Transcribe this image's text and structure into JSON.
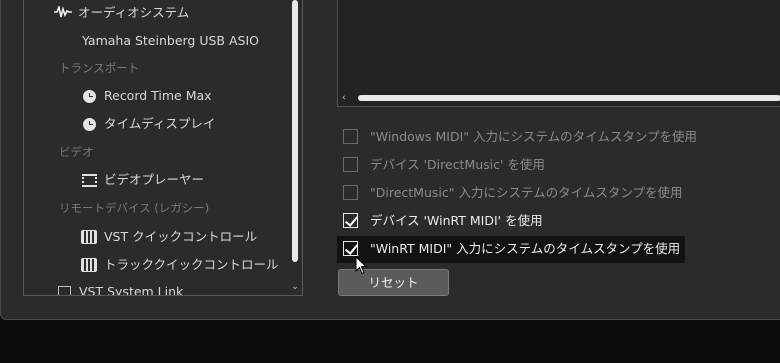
{
  "tree": {
    "items": [
      {
        "label": "オーディオシステム",
        "kind": "item",
        "icon": "audio-waveform-icon"
      },
      {
        "label": "Yamaha Steinberg USB ASIO",
        "kind": "item",
        "icon": ""
      },
      {
        "label": "トランスポート",
        "kind": "category"
      },
      {
        "label": "Record Time Max",
        "kind": "item",
        "icon": "clock-icon"
      },
      {
        "label": "タイムディスプレイ",
        "kind": "item",
        "icon": "clock-icon"
      },
      {
        "label": "ビデオ",
        "kind": "category"
      },
      {
        "label": "ビデオプレーヤー",
        "kind": "item",
        "icon": "film-icon"
      },
      {
        "label": "リモートデバイス (レガシー)",
        "kind": "category"
      },
      {
        "label": "VST クイックコントロール",
        "kind": "item",
        "icon": "keyboard-icon"
      },
      {
        "label": "トラッククイックコントロール",
        "kind": "item",
        "icon": "keyboard-icon"
      },
      {
        "label": "VST System Link",
        "kind": "item",
        "icon": "checkbox-icon"
      }
    ]
  },
  "options": [
    {
      "label": "\"Windows MIDI\" 入力にシステムのタイムスタンプを使用",
      "checked": false,
      "enabled": false
    },
    {
      "label": "デバイス 'DirectMusic' を使用",
      "checked": false,
      "enabled": false
    },
    {
      "label": "\"DirectMusic\" 入力にシステムのタイムスタンプを使用",
      "checked": false,
      "enabled": false
    },
    {
      "label": "デバイス 'WinRT MIDI' を使用",
      "checked": true,
      "enabled": true
    },
    {
      "label": "\"WinRT MIDI\" 入力にシステムのタイムスタンプを使用",
      "checked": true,
      "enabled": true
    }
  ],
  "reset_button": {
    "label": "リセット"
  },
  "colors": {
    "background": "#2b2b2d",
    "panel": "#232325",
    "button": "#5b5b5d",
    "accent_text": "#ececec",
    "disabled_text": "#8b8b8d"
  }
}
